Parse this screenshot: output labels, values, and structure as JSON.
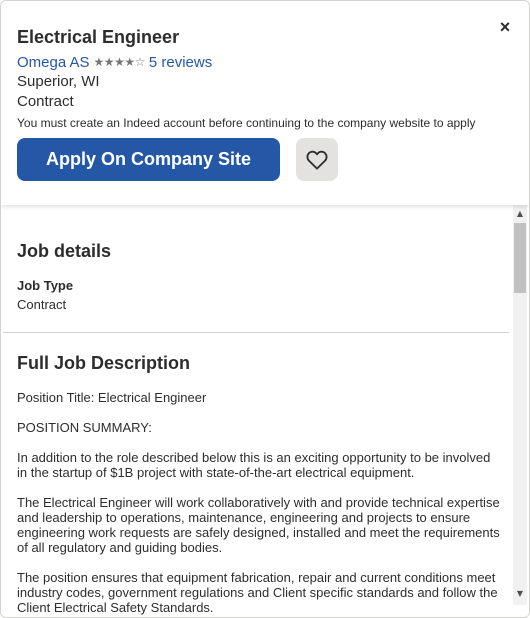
{
  "header": {
    "job_title": "Electrical Engineer",
    "close_glyph": "×",
    "company_name": "Omega AS",
    "rating_stars": "★★★★☆",
    "reviews": "5 reviews",
    "location": "Superior, WI",
    "job_type": "Contract",
    "notice": "You must create an Indeed account before continuing to the company website to apply",
    "apply_label": "Apply On Company Site",
    "save_icon": "heart-icon"
  },
  "details": {
    "title": "Job details",
    "job_type_label": "Job Type",
    "job_type_value": "Contract"
  },
  "description": {
    "title": "Full Job Description",
    "paragraphs": [
      "Position Title: Electrical Engineer",
      "POSITION SUMMARY:",
      "In addition to the role described below this is an exciting opportunity to be involved in the startup of $1B project with state-of-the-art electrical equipment.",
      "The Electrical Engineer will work collaboratively with and provide technical expertise and leadership to operations, maintenance, engineering and projects to ensure engineering work requests are safely designed, installed and meet the requirements of all regulatory and guiding bodies.",
      "The position ensures that equipment fabrication, repair and current conditions meet industry codes, government regulations and Client specific standards and follow the Client Electrical Safety Standards."
    ]
  },
  "scrollbar": {
    "up_glyph": "▲",
    "down_glyph": "▼"
  },
  "colors": {
    "accent": "#2557a7",
    "text": "#2d2d2d",
    "star": "#767676",
    "save_bg": "#e4e2e0"
  }
}
